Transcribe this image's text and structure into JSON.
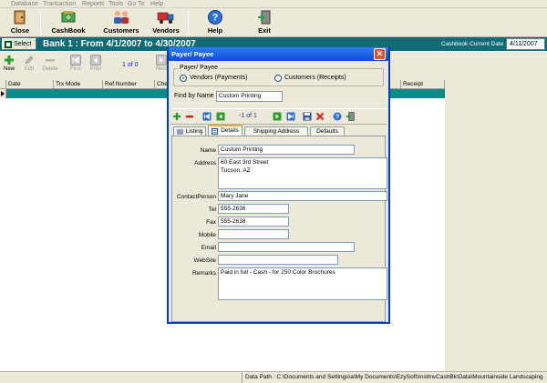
{
  "menu": [
    "Database",
    "Transaction",
    "Reports",
    "Tools",
    "Go To",
    "Help"
  ],
  "toolbar": {
    "close": "Close",
    "cashbook": "CashBook",
    "customers": "Customers",
    "vendors": "Vendors",
    "help": "Help",
    "exit": "Exit"
  },
  "bankbar": {
    "select_label": "Select",
    "title": "Bank 1 :  From  4/1/2007  to  4/30/2007",
    "cashbook_date_label": "Cashbook Current Date",
    "cashbook_date_value": "4/11/2007"
  },
  "records_toolbar": {
    "new": "New",
    "edit": "Edit",
    "delete": "Delete",
    "first": "First",
    "prior": "Prior",
    "next": "Next",
    "count": "1 of 0"
  },
  "grid": {
    "columns": [
      "Date",
      "Trx Mode",
      "Ref Number",
      "Che",
      "Receipt"
    ]
  },
  "status": {
    "data_path": "Data Path : C:\\Documents and Settings\\a\\My Documents\\EzySoft\\InstInvCashBk\\Data\\Mountainside Landscaping"
  },
  "dialog": {
    "title": "Payer/ Payee",
    "group_title": "Payer/ Payee",
    "radio_vendors": "Vendors (Payments)",
    "radio_customers": "Customers (Receipts)",
    "selected_radio": "vendors",
    "find_label": "Find by Name",
    "find_value": "Custom Printing",
    "nav_count": "-1 of 1",
    "tabs": {
      "listing": "Listing",
      "details": "Details",
      "shipping": "Shipping Address",
      "defaults": "Defaults"
    },
    "fields": {
      "name_label": "Name",
      "name_value": "Custom Printing",
      "address_label": "Address",
      "address_value": "60 East 3rd Street\nTucson, AZ",
      "contact_label": "ContactPerson",
      "contact_value": "Mary Jane",
      "tel_label": "Tel",
      "tel_value": "555-2636",
      "fax_label": "Fax",
      "fax_value": "555-2638",
      "mobile_label": "Mobile",
      "mobile_value": "",
      "email_label": "Email",
      "email_value": "",
      "website_label": "WebSite",
      "website_value": "",
      "remarks_label": "Remarks",
      "remarks_value": "Paid in full - Cash - for 250 Color Brochures"
    }
  },
  "colors": {
    "bank_bar": "#0f6b76",
    "grid_row": "#0f8a8a",
    "dialog_title": "#0a4fd6"
  }
}
